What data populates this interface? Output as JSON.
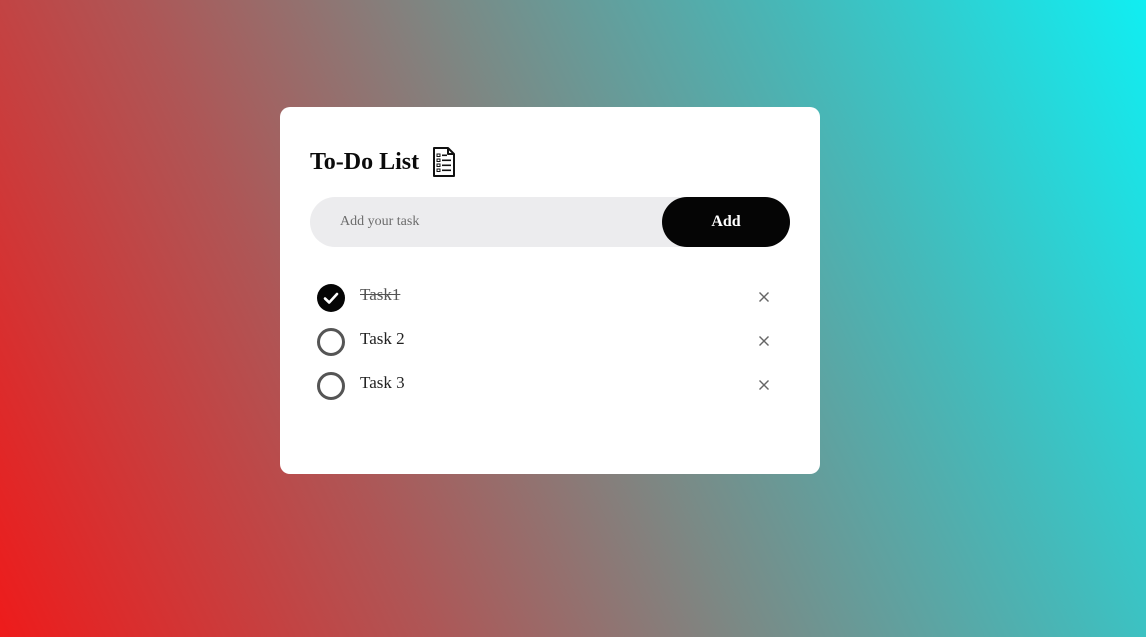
{
  "app": {
    "title": "To-Do List",
    "title_icon": "notepad-checklist-icon"
  },
  "input": {
    "placeholder": "Add your task",
    "value": ""
  },
  "add_button": {
    "label": "Add"
  },
  "tasks": [
    {
      "text": "Task1",
      "completed": true,
      "remove_icon": "close-icon"
    },
    {
      "text": "Task 2",
      "completed": false,
      "remove_icon": "close-icon"
    },
    {
      "text": "Task 3",
      "completed": false,
      "remove_icon": "close-icon"
    }
  ],
  "colors": {
    "accent": "#050505",
    "input_background": "#ececee",
    "card_background": "#ffffff",
    "gradient_start": "#ee1b1b",
    "gradient_end": "#10eef2"
  }
}
